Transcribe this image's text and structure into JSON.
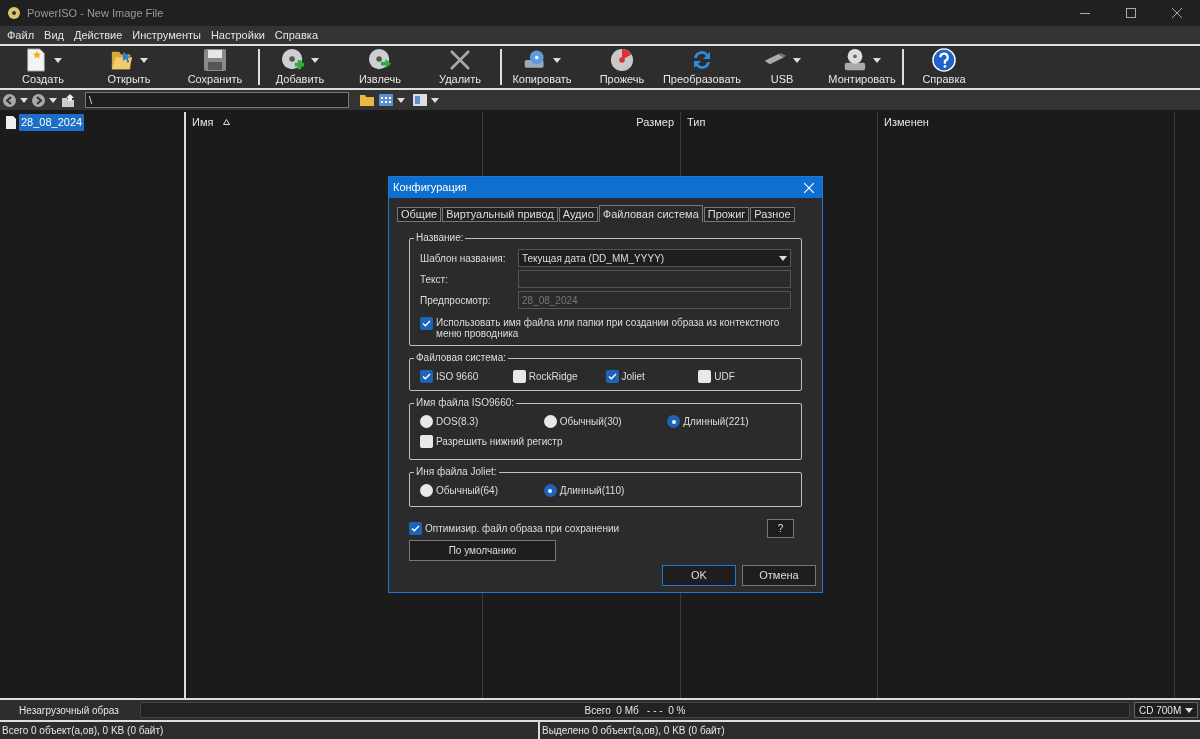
{
  "window": {
    "title": "PowerISO - New Image File"
  },
  "menu": [
    "Файл",
    "Вид",
    "Действие",
    "Инструменты",
    "Настройки",
    "Справка"
  ],
  "toolbar_groups": [
    [
      {
        "label": "Создать",
        "dropdown": true
      },
      {
        "label": "Открыть",
        "dropdown": true
      },
      {
        "label": "Сохранить",
        "dropdown": false
      }
    ],
    [
      {
        "label": "Добавить",
        "dropdown": true
      },
      {
        "label": "Извлечь",
        "dropdown": false
      },
      {
        "label": "Удалить",
        "dropdown": false
      }
    ],
    [
      {
        "label": "Копировать",
        "dropdown": true
      },
      {
        "label": "Прожечь",
        "dropdown": false
      },
      {
        "label": "Преобразовать",
        "dropdown": false
      },
      {
        "label": "USB",
        "dropdown": true
      },
      {
        "label": "Монтировать",
        "dropdown": true
      }
    ],
    [
      {
        "label": "Справка",
        "dropdown": false
      }
    ]
  ],
  "address": {
    "value": "\\"
  },
  "tree": [
    {
      "label": "28_08_2024",
      "selected": true
    }
  ],
  "columns": [
    "Имя",
    "Размер",
    "Тип",
    "Изменен"
  ],
  "dialog": {
    "title": "Конфигурация",
    "tabs": [
      {
        "label": "Общие",
        "selected": false
      },
      {
        "label": "Виртуальный привод",
        "selected": false
      },
      {
        "label": "Аудио",
        "selected": false
      },
      {
        "label": "Файловая система",
        "selected": true
      },
      {
        "label": "Прожиг",
        "selected": false
      },
      {
        "label": "Разное",
        "selected": false
      }
    ],
    "name_group": {
      "title": "Название:",
      "template_label": "Шаблон названия:",
      "template_value": "Текущая дата (DD_MM_YYYY)",
      "text_label": "Текст:",
      "preview_label": "Предпросмотр:",
      "preview_value": "28_08_2024",
      "use_filename": {
        "label": "Использовать имя файла или папки при создании образа из контекстного меню проводника",
        "checked": true
      }
    },
    "fs_group": {
      "title": "Файловая система:",
      "options": [
        {
          "label": "ISO 9660",
          "checked": true
        },
        {
          "label": "RockRidge",
          "checked": false
        },
        {
          "label": "Joliet",
          "checked": true
        },
        {
          "label": "UDF",
          "checked": false
        }
      ]
    },
    "iso_group": {
      "title": "Имя файла ISO9660:",
      "options": [
        {
          "label": "DOS(8.3)",
          "selected": false
        },
        {
          "label": "Обычный(30)",
          "selected": false
        },
        {
          "label": "Длинный(221)",
          "selected": true
        }
      ],
      "lowercase": {
        "label": "Разрешить нижний регистр",
        "checked": false
      }
    },
    "joliet_group": {
      "title": "Иня файла Joliet:",
      "options": [
        {
          "label": "Обычный(64)",
          "selected": false
        },
        {
          "label": "Длинный(110)",
          "selected": true
        }
      ]
    },
    "optimize": {
      "label": "Оптимизир. файл образа при сохранении",
      "checked": true
    },
    "help_button": "?",
    "default_button": "По умолчанию",
    "ok_button": "OK",
    "cancel_button": "Отмена"
  },
  "status": {
    "boot": "Незагрузочный образ",
    "progress_text": "Всего  0 Мб   - - -  0 %",
    "media": "CD 700M"
  },
  "bottom": {
    "total": "Всего 0 объект(а,ов), 0 KB (0 байт)",
    "selected": "Выделено 0 объект(а,ов), 0 KB (0 байт)"
  }
}
